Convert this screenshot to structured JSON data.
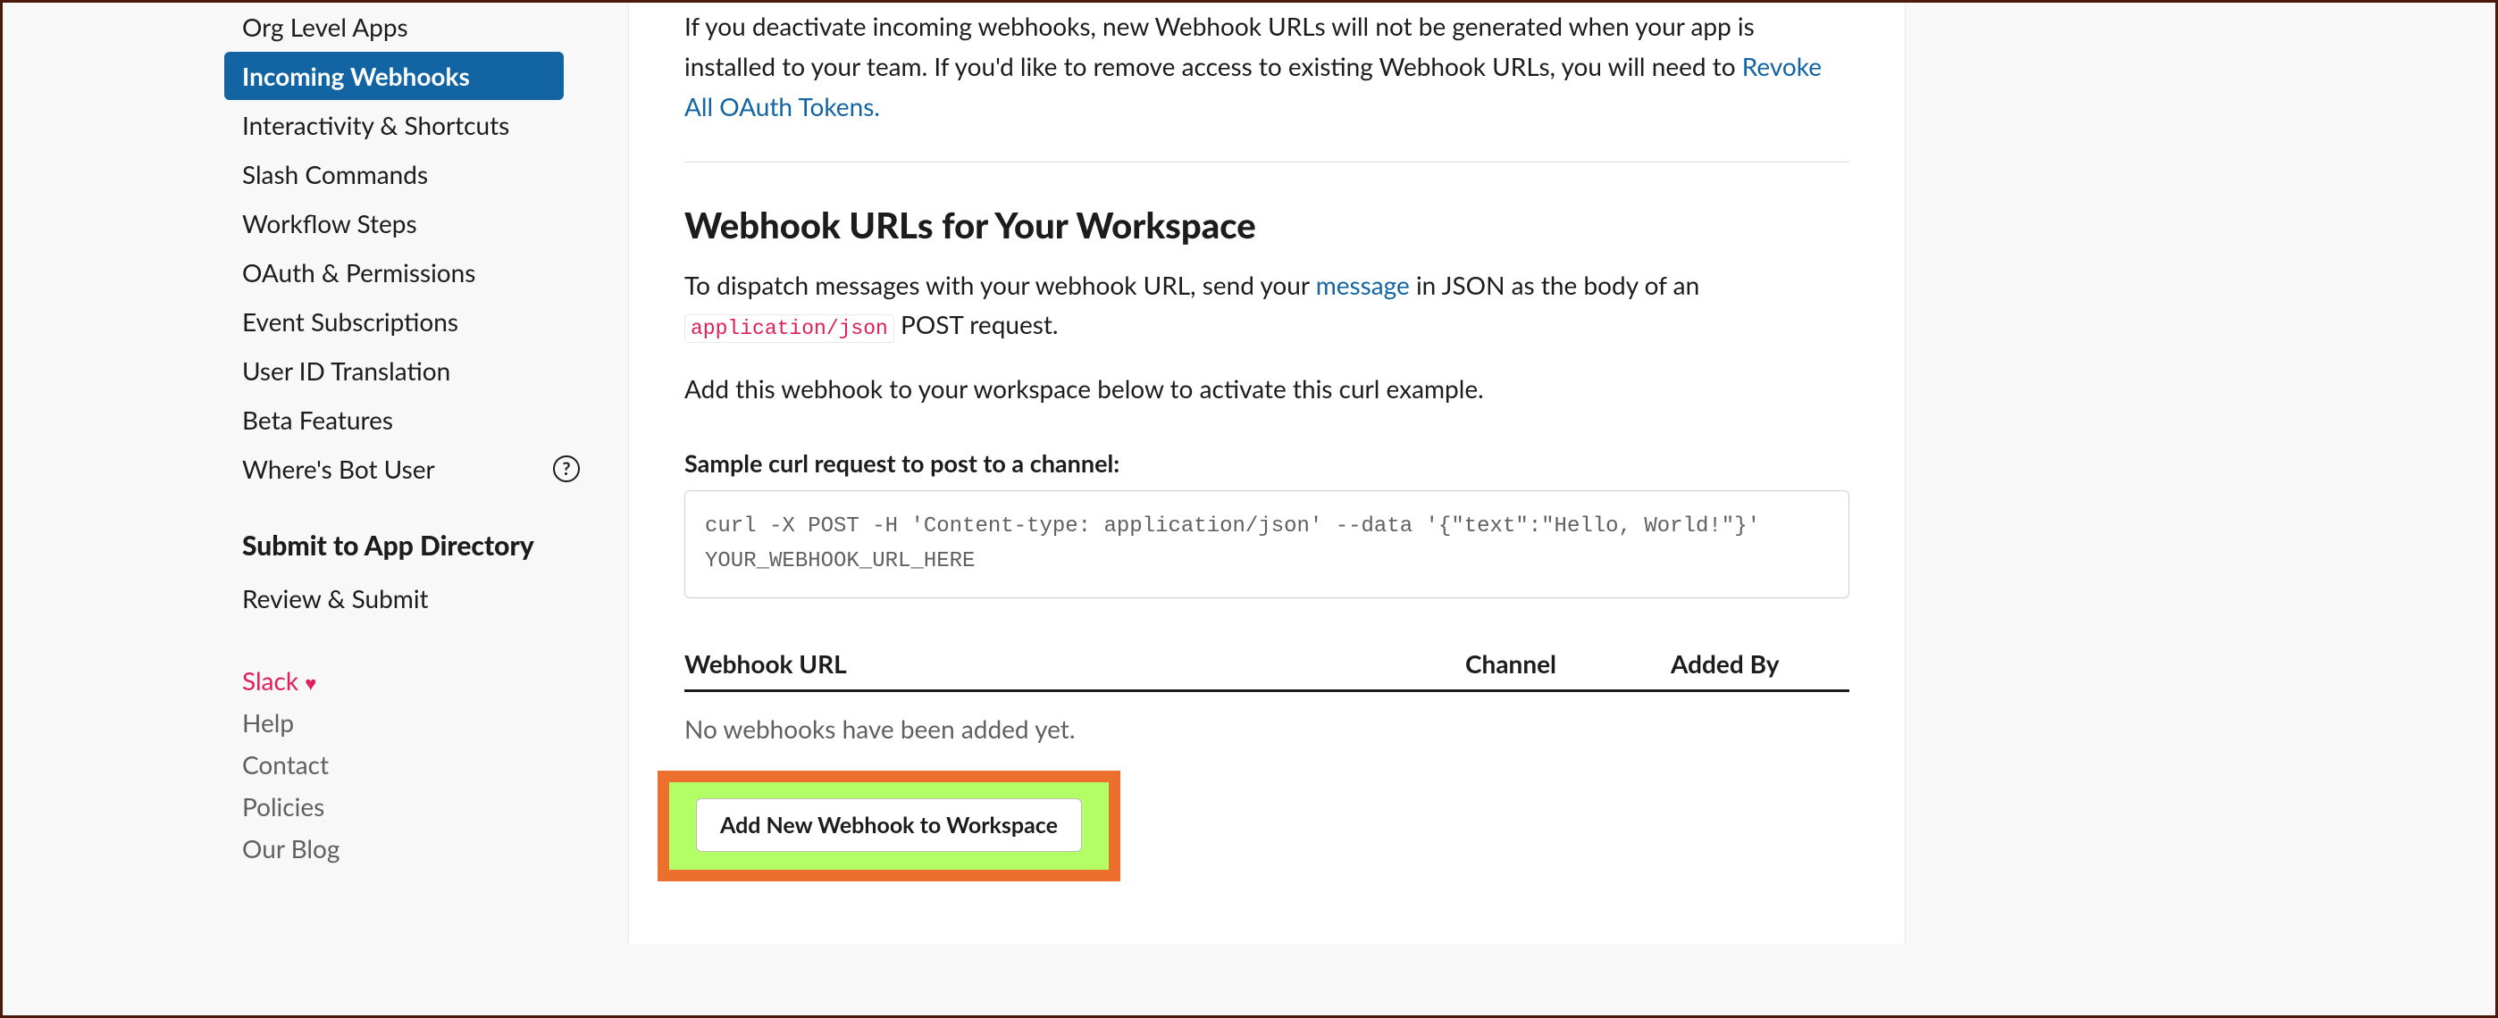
{
  "sidebar": {
    "nav": [
      {
        "label": "Org Level Apps",
        "active": false
      },
      {
        "label": "Incoming Webhooks",
        "active": true
      },
      {
        "label": "Interactivity & Shortcuts",
        "active": false
      },
      {
        "label": "Slash Commands",
        "active": false
      },
      {
        "label": "Workflow Steps",
        "active": false
      },
      {
        "label": "OAuth & Permissions",
        "active": false
      },
      {
        "label": "Event Subscriptions",
        "active": false
      },
      {
        "label": "User ID Translation",
        "active": false
      },
      {
        "label": "Beta Features",
        "active": false
      },
      {
        "label": "Where's Bot User",
        "active": false,
        "help": true
      }
    ],
    "section_title": "Submit to App Directory",
    "review_link": "Review & Submit",
    "footer": {
      "slack": "Slack",
      "help": "Help",
      "contact": "Contact",
      "policies": "Policies",
      "blog": "Our Blog"
    }
  },
  "main": {
    "deactivate_text_1": "If you deactivate incoming webhooks, new Webhook URLs will not be generated when your app is installed to your team. If you'd like to remove access to existing Webhook URLs, you will need to ",
    "revoke_link": "Revoke All OAuth Tokens.",
    "section_heading": "Webhook URLs for Your Workspace",
    "dispatch_text_1": "To dispatch messages with your webhook URL, send your ",
    "message_link": "message",
    "dispatch_text_2": " in JSON as the body of an ",
    "code_inline": "application/json",
    "dispatch_text_3": " POST request.",
    "activate_text": "Add this webhook to your workspace below to activate this curl example.",
    "sample_label": "Sample curl request to post to a channel:",
    "curl_code": "curl -X POST -H 'Content-type: application/json' --data '{\"text\":\"Hello, World!\"}' YOUR_WEBHOOK_URL_HERE",
    "table": {
      "col_url": "Webhook URL",
      "col_channel": "Channel",
      "col_added": "Added By",
      "empty": "No webhooks have been added yet."
    },
    "add_button": "Add New Webhook to Workspace"
  }
}
